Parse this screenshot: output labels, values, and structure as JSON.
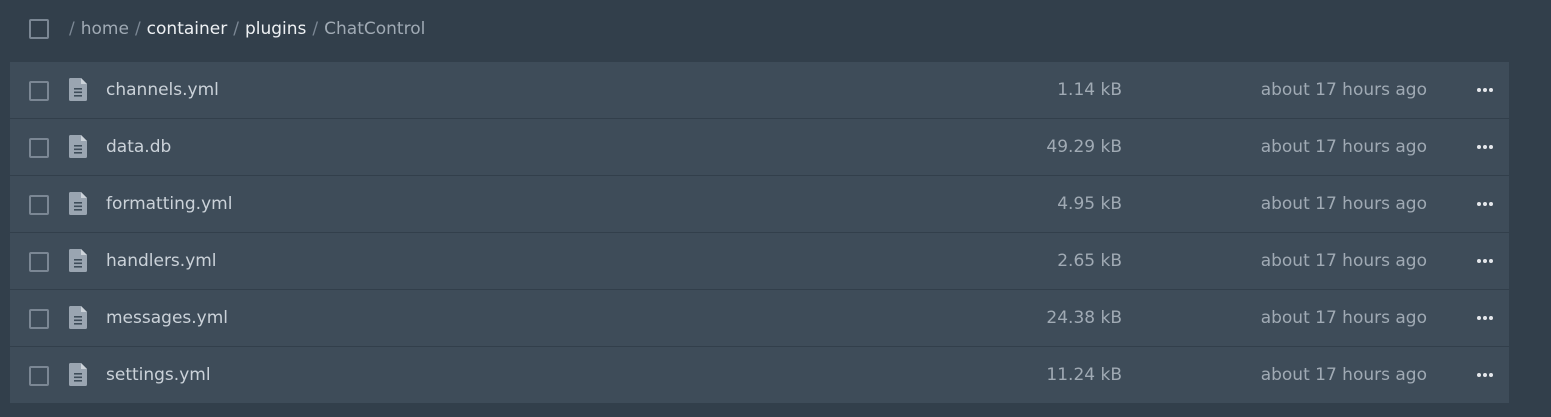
{
  "breadcrumb": {
    "separator": "/",
    "items": [
      {
        "label": "home"
      },
      {
        "label": "container"
      },
      {
        "label": "plugins"
      },
      {
        "label": "ChatControl"
      }
    ]
  },
  "files": [
    {
      "name": "channels.yml",
      "size": "1.14 kB",
      "modified": "about 17 hours ago"
    },
    {
      "name": "data.db",
      "size": "49.29 kB",
      "modified": "about 17 hours ago"
    },
    {
      "name": "formatting.yml",
      "size": "4.95 kB",
      "modified": "about 17 hours ago"
    },
    {
      "name": "handlers.yml",
      "size": "2.65 kB",
      "modified": "about 17 hours ago"
    },
    {
      "name": "messages.yml",
      "size": "24.38 kB",
      "modified": "about 17 hours ago"
    },
    {
      "name": "settings.yml",
      "size": "11.24 kB",
      "modified": "about 17 hours ago"
    }
  ],
  "icons": {
    "file": "file-text-icon",
    "more": "more-horizontal-icon"
  },
  "colors": {
    "background": "#323f4b",
    "row_background": "#3e4c59",
    "text": "#cbd2d9",
    "muted_text": "#a0aab4",
    "icon": "#9aa5b1"
  }
}
